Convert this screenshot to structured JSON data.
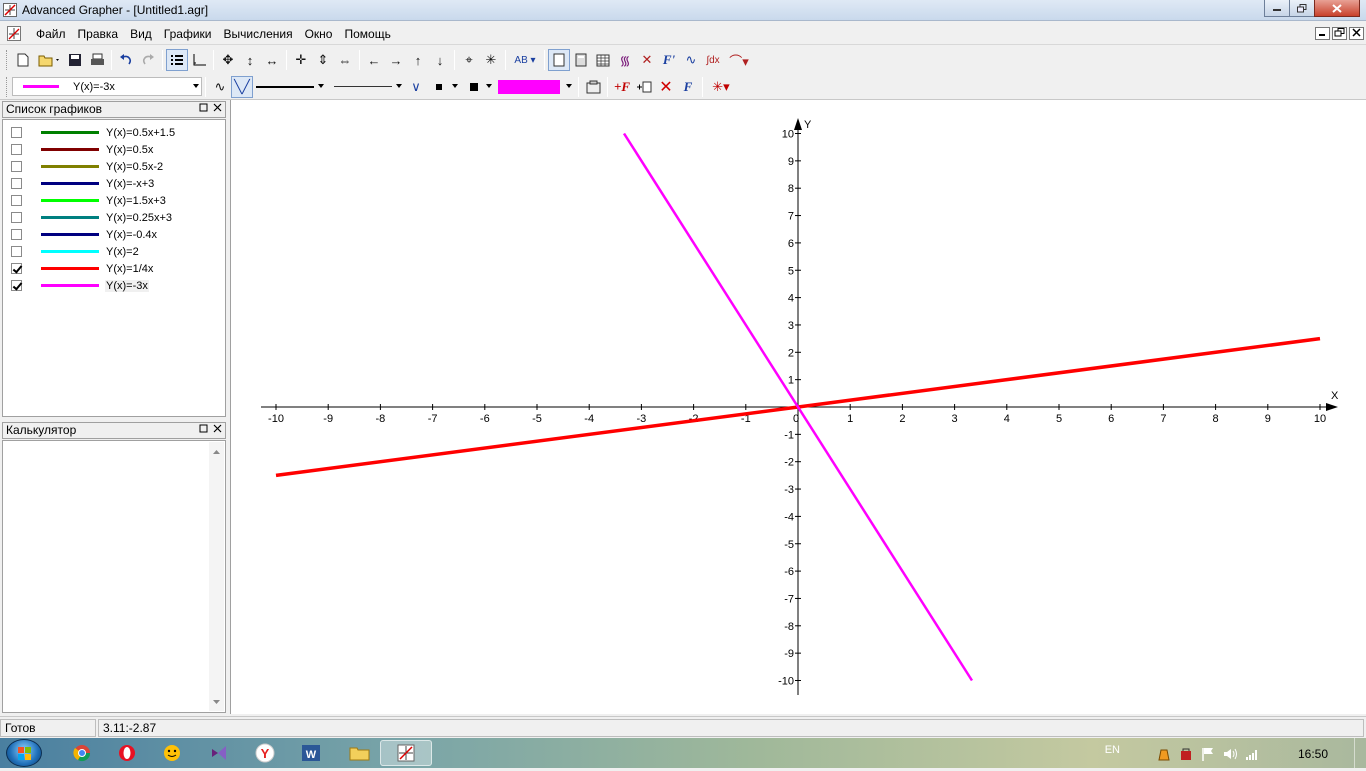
{
  "window": {
    "title": "Advanced Grapher - [Untitled1.agr]"
  },
  "menu": [
    "Файл",
    "Правка",
    "Вид",
    "Графики",
    "Вычисления",
    "Окно",
    "Помощь"
  ],
  "toolbar2": {
    "current_graph": "Y(x)=-3x",
    "current_color": "#ff00ff"
  },
  "graph_list": {
    "title": "Список графиков",
    "items": [
      {
        "label": "Y(x)=0.5x+1.5",
        "color": "#008000",
        "checked": false
      },
      {
        "label": "Y(x)=0.5x",
        "color": "#800000",
        "checked": false
      },
      {
        "label": "Y(x)=0.5x-2",
        "color": "#808000",
        "checked": false
      },
      {
        "label": "Y(x)=-x+3",
        "color": "#000080",
        "checked": false
      },
      {
        "label": "Y(x)=1.5x+3",
        "color": "#00ff00",
        "checked": false
      },
      {
        "label": "Y(x)=0.25x+3",
        "color": "#008080",
        "checked": false
      },
      {
        "label": "Y(x)=-0.4x",
        "color": "#000080",
        "checked": false
      },
      {
        "label": "Y(x)=2",
        "color": "#00ffff",
        "checked": false
      },
      {
        "label": "Y(x)=1/4x",
        "color": "#ff0000",
        "checked": true
      },
      {
        "label": "Y(x)=-3x",
        "color": "#ff00ff",
        "checked": true
      }
    ]
  },
  "calculator": {
    "title": "Калькулятор"
  },
  "chart_data": {
    "type": "line",
    "x_axis_label": "X",
    "y_axis_label": "Y",
    "xlim": [
      -10,
      10
    ],
    "ylim": [
      -10,
      10
    ],
    "x_ticks": [
      -10,
      -9,
      -8,
      -7,
      -6,
      -5,
      -4,
      -3,
      -2,
      -1,
      0,
      1,
      2,
      3,
      4,
      5,
      6,
      7,
      8,
      9,
      10
    ],
    "y_ticks": [
      -10,
      -9,
      -8,
      -7,
      -6,
      -5,
      -4,
      -3,
      -2,
      -1,
      1,
      2,
      3,
      4,
      5,
      6,
      7,
      8,
      9,
      10
    ],
    "grid": false,
    "series": [
      {
        "name": "Y(x)=1/4x",
        "color": "#ff0000",
        "x": [
          -10,
          10
        ],
        "y": [
          -2.5,
          2.5
        ]
      },
      {
        "name": "Y(x)=-3x",
        "color": "#ff00ff",
        "x": [
          -3.333,
          3.333
        ],
        "y": [
          10,
          -10
        ]
      }
    ]
  },
  "status": {
    "state": "Готов",
    "coords": "3.11:-2.87"
  },
  "tray": {
    "lang": "EN",
    "time": "16:50"
  }
}
